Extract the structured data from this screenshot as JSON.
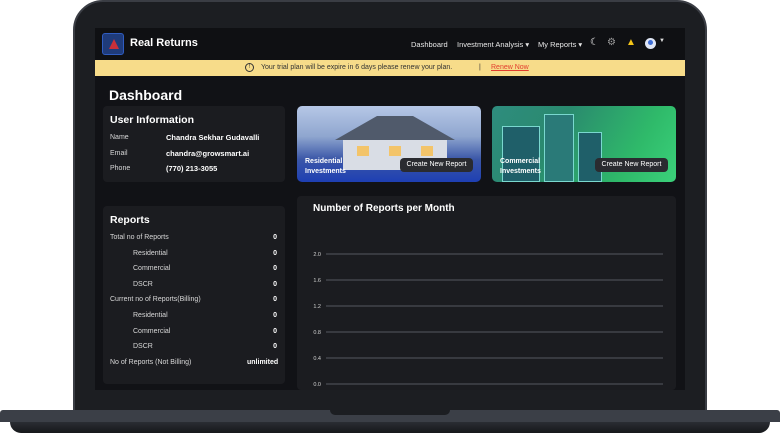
{
  "nav": {
    "brand": "Real Returns",
    "links": [
      "Dashboard",
      "Investment Analysis ▾",
      "My Reports ▾"
    ],
    "icons": [
      "moon-icon",
      "gear-icon",
      "bell-icon",
      "user-avatar-icon"
    ]
  },
  "trial": {
    "icon": "!",
    "message": "Your trial plan will be expire in 6 days please renew your plan.",
    "separator": "|",
    "link": "Renew Now"
  },
  "page_title": "Dashboard",
  "user_info": {
    "title": "User Information",
    "rows": [
      {
        "label": "Name",
        "value": "Chandra Sekhar Gudavalli"
      },
      {
        "label": "Email",
        "value": "chandra@growsmart.ai"
      },
      {
        "label": "Phone",
        "value": "(770) 213-3055"
      }
    ]
  },
  "heroes": [
    {
      "label": "Residential Investments",
      "button": "Create New Report"
    },
    {
      "label": "Commercial Investments",
      "button": "Create New Report"
    }
  ],
  "reports": {
    "title": "Reports",
    "rows": [
      {
        "label": "Total no of Reports",
        "value": "0"
      },
      {
        "label": "Residential",
        "value": "0"
      },
      {
        "label": "Commercial",
        "value": "0"
      },
      {
        "label": "DSCR",
        "value": "0"
      },
      {
        "label": "Current no of Reports(Billing)",
        "value": "0"
      },
      {
        "label": "Residential",
        "value": "0"
      },
      {
        "label": "Commercial",
        "value": "0"
      },
      {
        "label": "DSCR",
        "value": "0"
      },
      {
        "label": "No of Reports (Not Billing)",
        "value": "unlimited"
      }
    ]
  },
  "chart_data": {
    "type": "line",
    "title": "Number of Reports per Month",
    "xlabel": "",
    "ylabel": "",
    "yticks": [
      "2.0",
      "1.6",
      "1.2",
      "0.8",
      "0.4",
      "0.0"
    ],
    "ylim": [
      0,
      2.0
    ],
    "grid": true,
    "series": []
  },
  "colors": {
    "accent": "#f7dc8a",
    "link": "#e23d2d",
    "bell": "#f5c518"
  }
}
